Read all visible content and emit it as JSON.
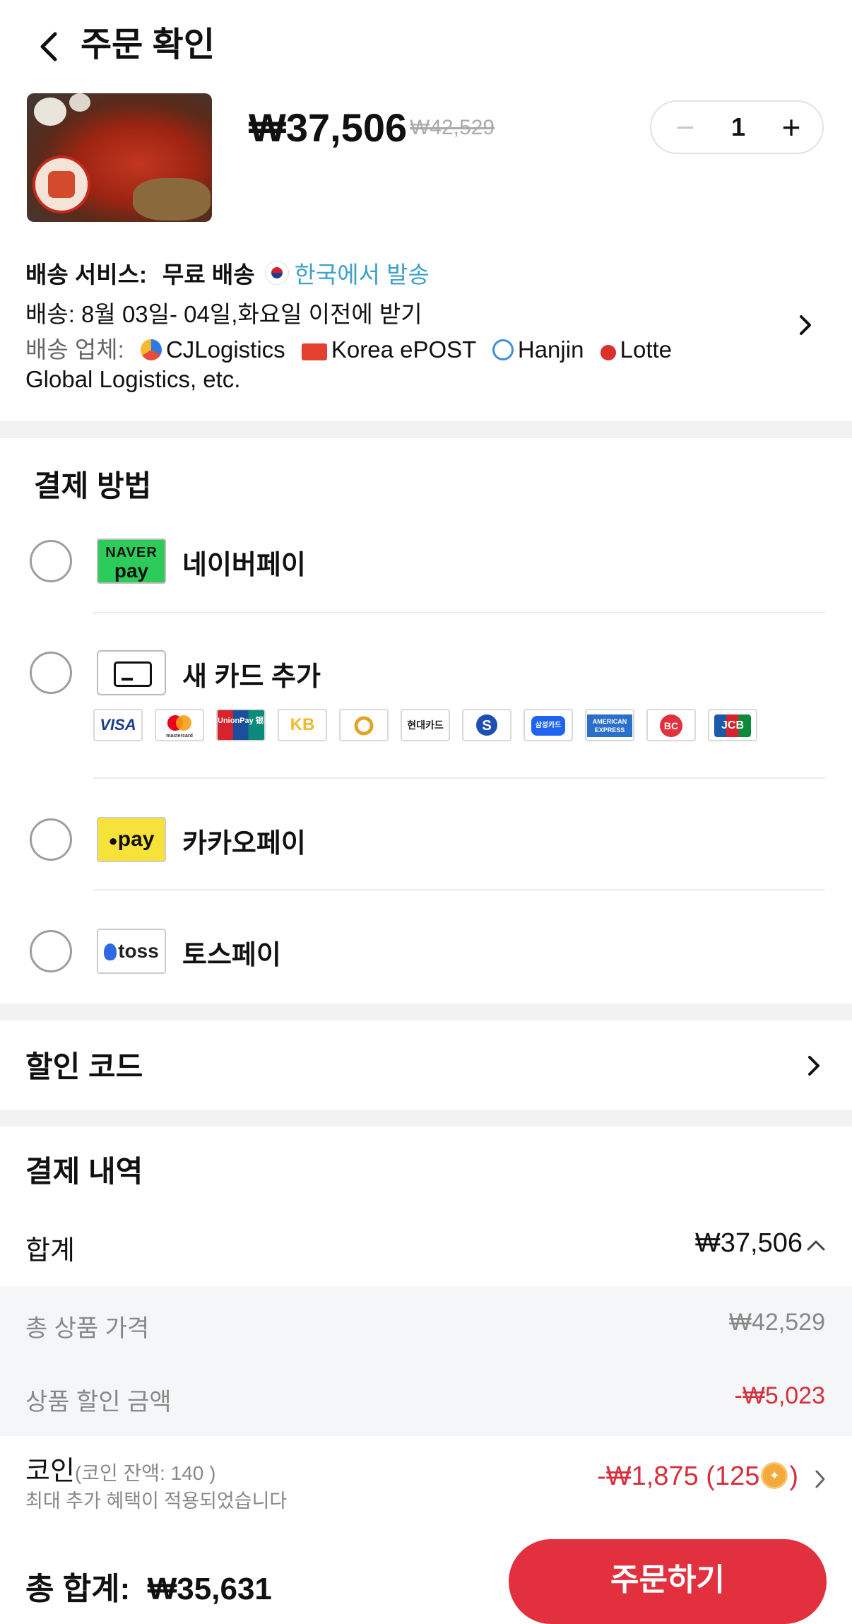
{
  "header": {
    "title": "주문 확인",
    "back_icon": "chevron-left-icon"
  },
  "product": {
    "price": "₩37,506",
    "original_price": "₩42,529",
    "quantity": "1",
    "minus_label": "−",
    "plus_label": "+"
  },
  "shipping": {
    "service_label": "배송 서비스:",
    "service_value": "무료 배송",
    "origin": "한국에서 발송",
    "delivery": "배송: 8월 03일- 04일,화요일 이전에 받기",
    "carriers_label": "배송 업체:",
    "carriers": [
      "CJLogistics",
      "Korea ePOST",
      "Hanjin",
      "Lotte"
    ],
    "carriers_tail": "Global Logistics, etc."
  },
  "payment": {
    "title": "결제 방법",
    "methods": [
      {
        "label": "네이버페이",
        "logo_top": "NAVER",
        "logo_bottom": "pay"
      },
      {
        "label": "새 카드 추가"
      },
      {
        "label": "카카오페이",
        "logo_text": "pay"
      },
      {
        "label": "토스페이",
        "logo_text": "toss"
      }
    ],
    "card_brands": [
      "VISA",
      "mastercard",
      "UnionPay 银联",
      "KB",
      "NH",
      "현대카드",
      "신한",
      "삼성카드",
      "AMERICAN EXPRESS",
      "BC",
      "JCB"
    ]
  },
  "discount": {
    "label": "할인 코드"
  },
  "summary": {
    "title": "결제 내역",
    "subtotal_label": "합계",
    "subtotal_value": "₩37,506",
    "items_label": "총 상품 가격",
    "items_value": "₩42,529",
    "product_discount_label": "상품 할인 금액",
    "product_discount_value": "-₩5,023",
    "coin_label": "코인",
    "coin_balance": "(코인 잔액: 140 )",
    "coin_note": "최대 추가 혜택이 적용되었습니다",
    "coin_value": "-₩1,875 (125",
    "coin_value_end": ")"
  },
  "footer": {
    "total_label": "총 합계:",
    "total_value": "₩35,631",
    "order_button": "주문하기"
  },
  "colors": {
    "accent_red": "#e2303e",
    "discount_red": "#d4303d",
    "link_blue": "#3fa0c9",
    "naver_green": "#2dcc5a",
    "kakao_yellow": "#f7e23a"
  }
}
